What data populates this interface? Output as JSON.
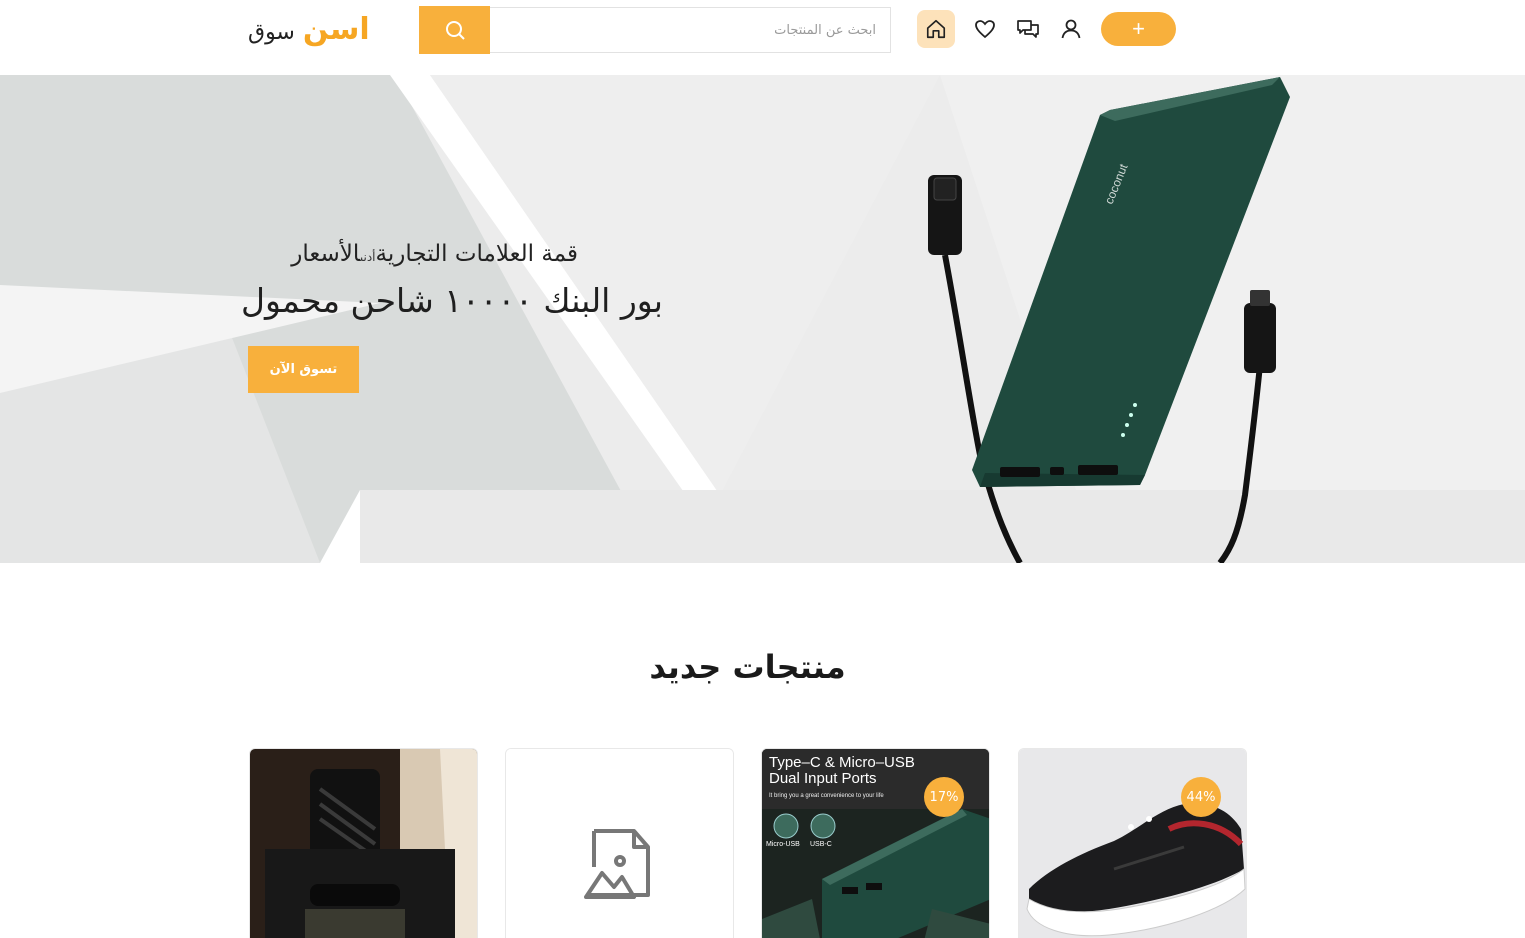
{
  "header": {
    "logo_part_a": "اسن",
    "logo_part_b": "سوق",
    "search_placeholder": "ابحث عن المنتجات",
    "add_label": "+"
  },
  "hero": {
    "subtitle_main": "قمة العلامات التجارية",
    "subtitle_small": "أدنى",
    "subtitle_end": "الأسعار",
    "title": "بور البنك ١٠٠٠٠ شاحن محمول",
    "cta_label": "تسوق الآن",
    "product_brand": "coconut"
  },
  "new_products": {
    "title": "منتجات جديد",
    "cards": [
      {
        "kind": "photo-box"
      },
      {
        "kind": "placeholder"
      },
      {
        "kind": "powerbank",
        "discount": "17%",
        "caption_line1": "Type–C & Micro–USB",
        "caption_line2": "Dual Input Ports",
        "caption_small": "It bring you a great convenience to your life",
        "port_label_1": "Micro-USB",
        "port_label_2": "USB-C"
      },
      {
        "kind": "shoe",
        "discount": "44%"
      }
    ]
  },
  "colors": {
    "accent": "#f8b03c",
    "logo_accent": "#f6a623",
    "home_bg": "#fde2ba",
    "hero_bg": "#ececec",
    "powerbank_green": "#1f4a3e"
  }
}
